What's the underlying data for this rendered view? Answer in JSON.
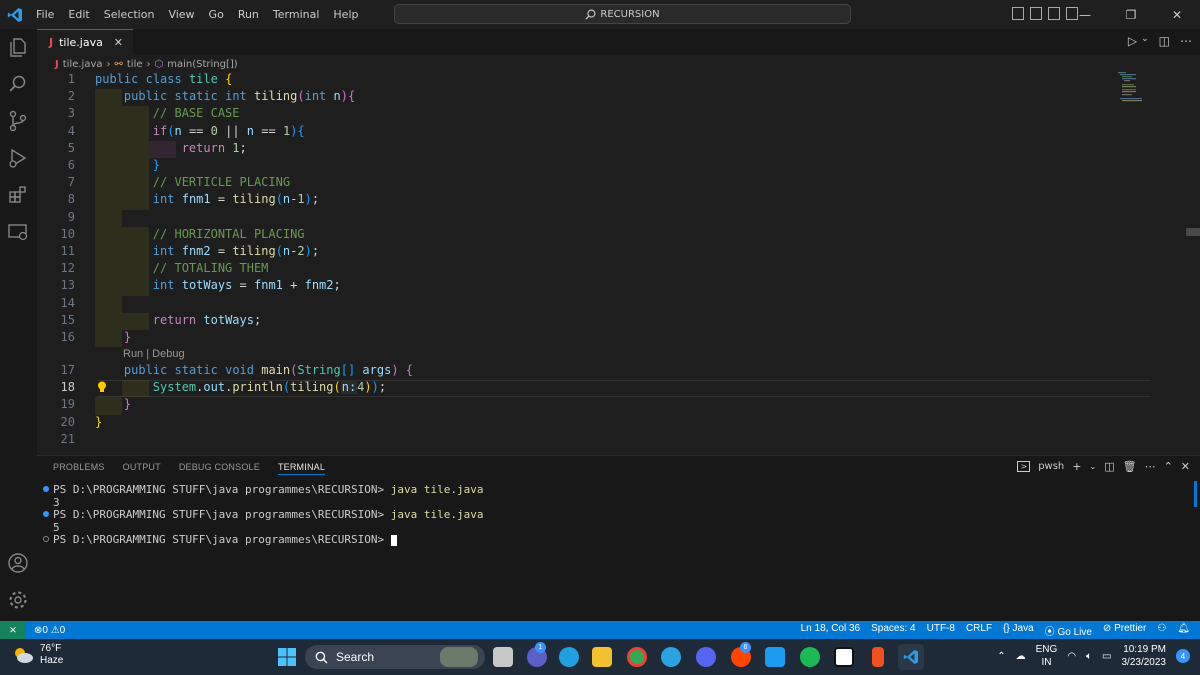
{
  "titlebar": {
    "menu": [
      "File",
      "Edit",
      "Selection",
      "View",
      "Go",
      "Run",
      "Terminal",
      "Help"
    ],
    "search": "RECURSION"
  },
  "tab": {
    "filename": "tile.java"
  },
  "breadcrumb": {
    "file": "tile.java",
    "class": "tile",
    "method": "main(String[])"
  },
  "editor": {
    "line_numbers": [
      "1",
      "2",
      "3",
      "4",
      "5",
      "6",
      "7",
      "8",
      "9",
      "10",
      "11",
      "12",
      "13",
      "14",
      "15",
      "16",
      "17",
      "18",
      "19",
      "20",
      "21"
    ],
    "codelens": "Run | Debug",
    "inlay_hint": "n:",
    "current_line": "18"
  },
  "panel": {
    "tabs": [
      "PROBLEMS",
      "OUTPUT",
      "DEBUG CONSOLE",
      "TERMINAL"
    ],
    "shell": "pwsh",
    "terminal": [
      {
        "prompt": "PS D:\\PROGRAMMING STUFF\\java programmes\\RECURSION> ",
        "cmd": "java tile.java",
        "mark": "blue"
      },
      {
        "prompt": "3",
        "cmd": "",
        "mark": ""
      },
      {
        "prompt": "PS D:\\PROGRAMMING STUFF\\java programmes\\RECURSION> ",
        "cmd": "java tile.java",
        "mark": "blue"
      },
      {
        "prompt": "5",
        "cmd": "",
        "mark": ""
      },
      {
        "prompt": "PS D:\\PROGRAMMING STUFF\\java programmes\\RECURSION> ",
        "cmd": "",
        "mark": "hollow"
      }
    ]
  },
  "statusbar": {
    "problems": "⊗0 ⚠0",
    "position": "Ln 18, Col 36",
    "spaces": "Spaces: 4",
    "encoding": "UTF-8",
    "eol": "CRLF",
    "language": "{} Java",
    "golive": "Go Live",
    "prettier": "Prettier"
  },
  "taskbar": {
    "temp": "76°F",
    "weather": "Haze",
    "search": "Search",
    "lang1": "ENG",
    "lang2": "IN",
    "time": "10:19 PM",
    "date": "3/23/2023",
    "notif_count": "4",
    "badge_teams": "1",
    "badge_reddit": "6"
  },
  "colors": {
    "accent": "#0078d4",
    "statusbar": "#0078d4",
    "remote": "#16825d"
  }
}
